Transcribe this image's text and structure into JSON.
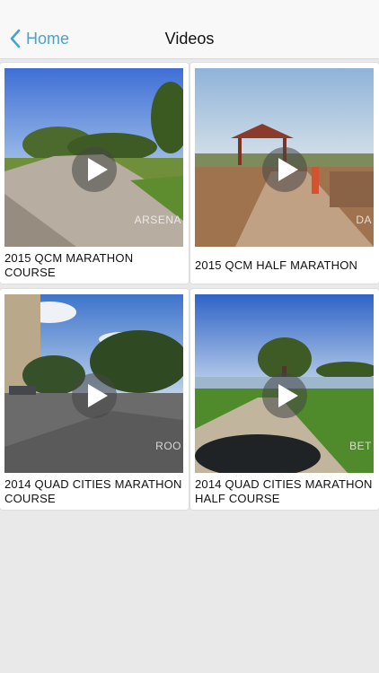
{
  "navbar": {
    "back_label": "Home",
    "title": "Videos"
  },
  "videos": [
    {
      "title": "2015 QCM MARATHON COURSE",
      "watermark": "ARSENA"
    },
    {
      "title": "2015 QCM HALF MARATHON",
      "watermark": "DA"
    },
    {
      "title": "2014 QUAD CITIES MARATHON COURSE",
      "watermark": "ROO"
    },
    {
      "title": "2014 QUAD CITIES MARATHON HALF COURSE",
      "watermark": "BET"
    }
  ],
  "colors": {
    "accent": "#4aa3c8",
    "background": "#e9e9ea"
  }
}
